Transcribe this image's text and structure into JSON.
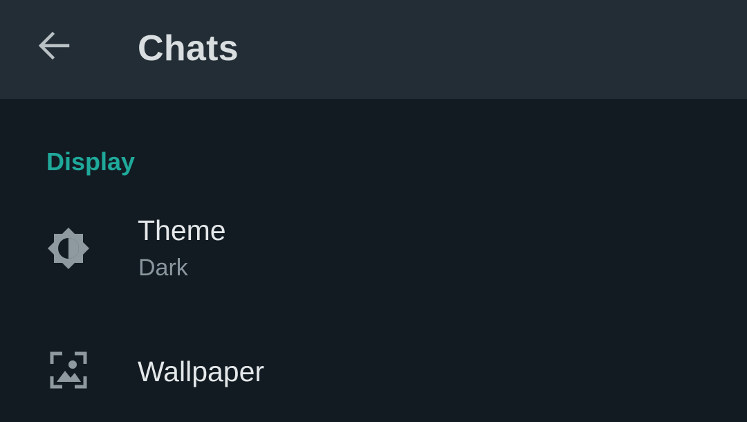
{
  "toolbar": {
    "back_icon": "arrow-left-icon",
    "title": "Chats"
  },
  "section": {
    "header": "Display",
    "items": [
      {
        "label": "Theme",
        "subtitle": "Dark",
        "icon": "brightness-icon"
      },
      {
        "label": "Wallpaper",
        "icon": "wallpaper-icon"
      }
    ]
  },
  "colors": {
    "toolbar_bg": "#232d36",
    "page_bg": "#121b22",
    "accent": "#1fa99a",
    "primary_text": "#e4e8ea",
    "secondary_text": "#8a969d",
    "icon": "#8e9a9f"
  }
}
